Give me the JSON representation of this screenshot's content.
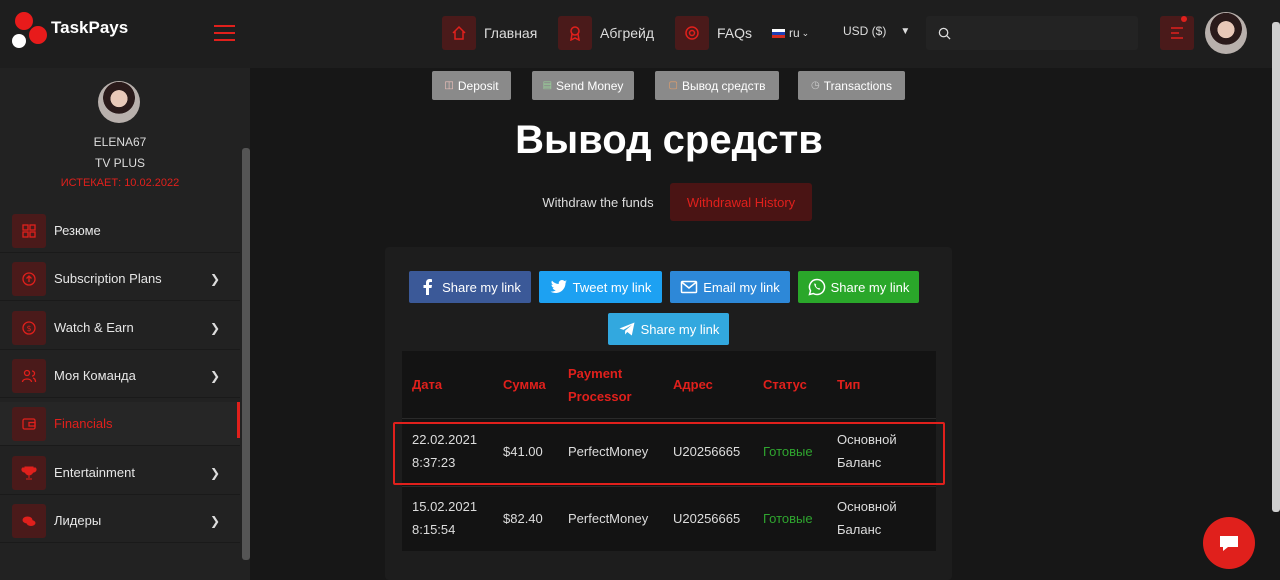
{
  "brand": {
    "name": "TaskPays"
  },
  "nav": {
    "home": "Главная",
    "upgrade": "Абгрейд",
    "faqs": "FAQs",
    "language": "ru",
    "currency": "USD ($)",
    "search_placeholder": ""
  },
  "profile": {
    "username": "ELENA67",
    "plan": "TV PLUS",
    "expires": "ИСТЕКАЕТ: 10.02.2022"
  },
  "sidebar": {
    "items": [
      {
        "label": "Резюме",
        "icon": "grid-icon",
        "chevron": false
      },
      {
        "label": "Subscription Plans",
        "icon": "upload-cloud-icon",
        "chevron": true
      },
      {
        "label": "Watch & Earn",
        "icon": "dollar-icon",
        "chevron": true
      },
      {
        "label": "Моя Команда",
        "icon": "users-icon",
        "chevron": true
      },
      {
        "label": "Financials",
        "icon": "wallet-icon",
        "chevron": false,
        "active": true
      },
      {
        "label": "Entertainment",
        "icon": "trophy-icon",
        "chevron": true
      },
      {
        "label": "Лидеры",
        "icon": "chat-bubbles-icon",
        "chevron": true
      }
    ]
  },
  "actions": {
    "deposit": "Deposit",
    "send_money": "Send Money",
    "withdraw": "Вывод средств",
    "transactions": "Transactions"
  },
  "page": {
    "title": "Вывод средств",
    "tab_withdraw": "Withdraw the funds",
    "tab_history": "Withdrawal History"
  },
  "share": {
    "facebook": "Share my link",
    "twitter": "Tweet my link",
    "email": "Email my link",
    "whatsapp": "Share my link",
    "telegram": "Share my link"
  },
  "table": {
    "headers": {
      "date": "Дата",
      "amount": "Сумма",
      "processor_line1": "Payment",
      "processor_line2": "Processor",
      "address": "Адрес",
      "status": "Статус",
      "type": "Тип"
    },
    "rows": [
      {
        "date": "22.02.2021",
        "time": "8:37:23",
        "amount": "$41.00",
        "processor": "PerfectMoney",
        "address": "U20256665",
        "status": "Готовые",
        "type_line1": "Основной",
        "type_line2": "Баланс"
      },
      {
        "date": "15.02.2021",
        "time": "8:15:54",
        "amount": "$82.40",
        "processor": "PerfectMoney",
        "address": "U20256665",
        "status": "Готовые",
        "type_line1": "Основной",
        "type_line2": "Баланс"
      }
    ]
  },
  "colors": {
    "accent": "#e0201c",
    "success": "#2fa52f",
    "facebook": "#3b5998",
    "twitter": "#1da1f2",
    "email": "#2d88d8",
    "whatsapp": "#2aa72a",
    "telegram": "#32a8df"
  }
}
